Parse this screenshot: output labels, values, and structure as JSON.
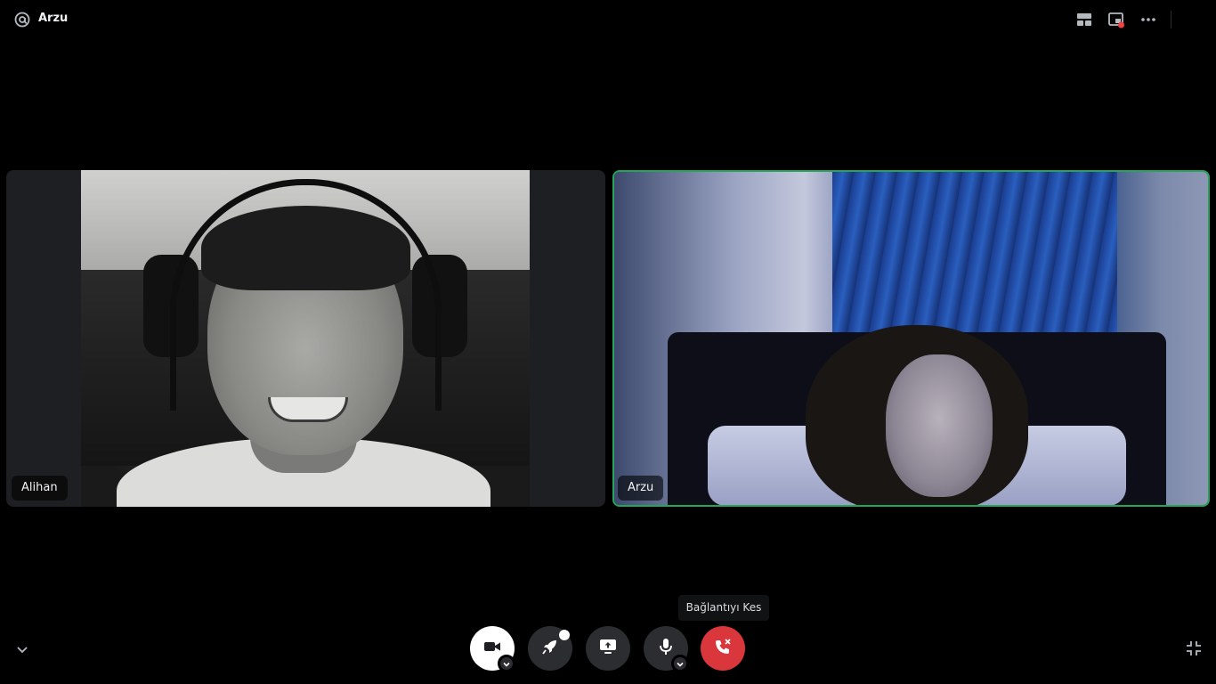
{
  "header": {
    "channel_name": "Arzu",
    "icons": [
      "at-sign-icon",
      "grid-layout-icon",
      "popout-window-icon",
      "more-options-icon"
    ]
  },
  "participants": [
    {
      "name": "Alihan",
      "speaking": false
    },
    {
      "name": "Arzu",
      "speaking": true
    }
  ],
  "controls": {
    "tooltip": "Bağlantıyı Kes",
    "buttons": [
      "camera-button",
      "activity-button",
      "share-screen-button",
      "microphone-button",
      "disconnect-button"
    ]
  },
  "colors": {
    "background": "#000000",
    "control_bg": "#2b2d31",
    "disconnect": "#da373c",
    "speaking_border": "#23a55a",
    "notification_dot": "#f23f43"
  }
}
